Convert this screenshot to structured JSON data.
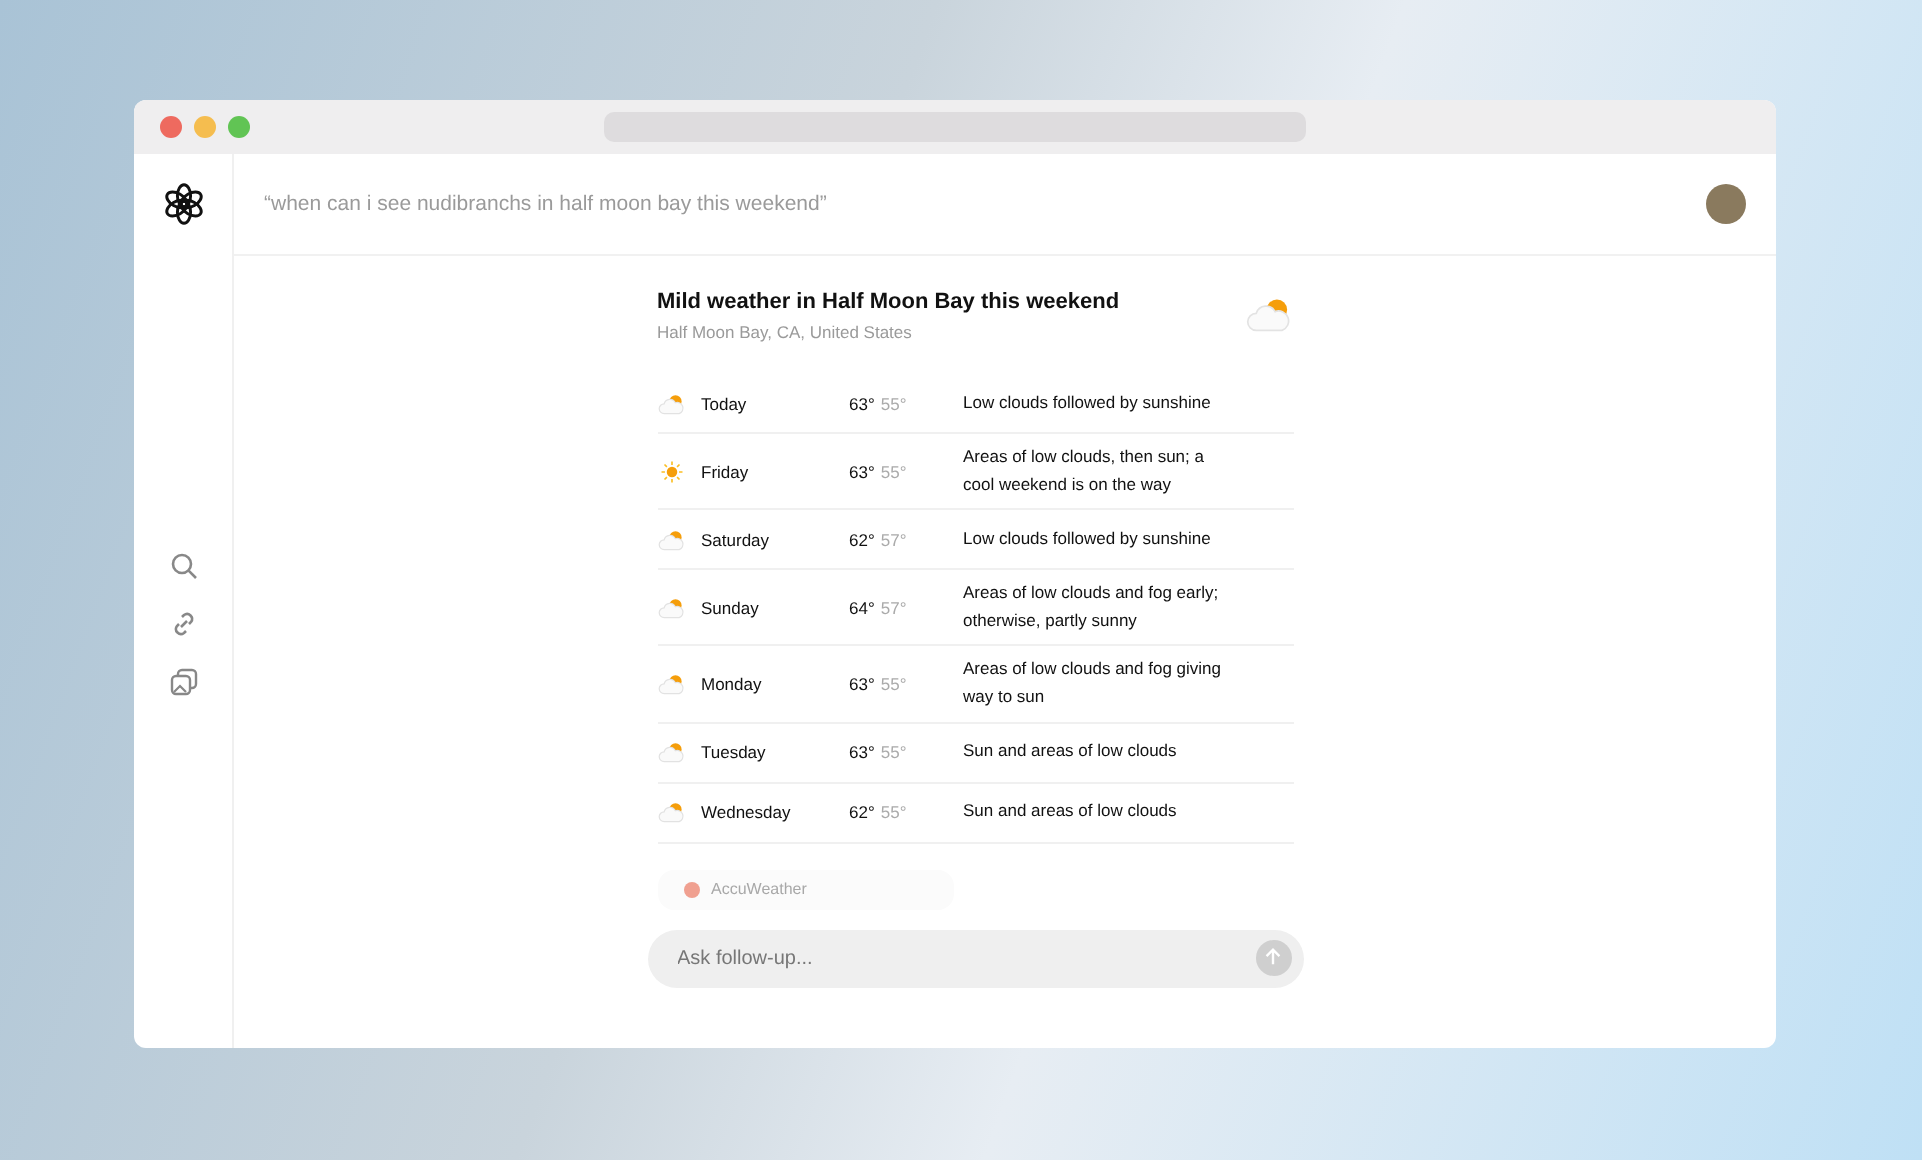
{
  "query": "“when can i see nudibranchs in half moon bay this weekend”",
  "weather": {
    "title": "Mild weather in Half Moon Bay this weekend",
    "location": "Half Moon Bay, CA, United States",
    "days": [
      {
        "kind": "cloudy",
        "day": "Today",
        "high": "63°",
        "low": "55°",
        "summary": "Low clouds followed by sunshine"
      },
      {
        "kind": "sunny",
        "day": "Friday",
        "high": "63°",
        "low": "55°",
        "summary": "Areas of low clouds, then sun; a cool weekend is on the way"
      },
      {
        "kind": "cloudy",
        "day": "Saturday",
        "high": "62°",
        "low": "57°",
        "summary": "Low clouds followed by sunshine"
      },
      {
        "kind": "cloudy",
        "day": "Sunday",
        "high": "64°",
        "low": "57°",
        "summary": "Areas of low clouds and fog early; otherwise, partly sunny"
      },
      {
        "kind": "cloudy",
        "day": "Monday",
        "high": "63°",
        "low": "55°",
        "summary": "Areas of low clouds and fog giving way to sun"
      },
      {
        "kind": "cloudy",
        "day": "Tuesday",
        "high": "63°",
        "low": "55°",
        "summary": "Sun and areas of low clouds"
      },
      {
        "kind": "cloudy",
        "day": "Wednesday",
        "high": "62°",
        "low": "55°",
        "summary": "Sun and areas of low clouds"
      }
    ],
    "source": "AccuWeather"
  },
  "composer": {
    "placeholder": "Ask follow-up..."
  }
}
